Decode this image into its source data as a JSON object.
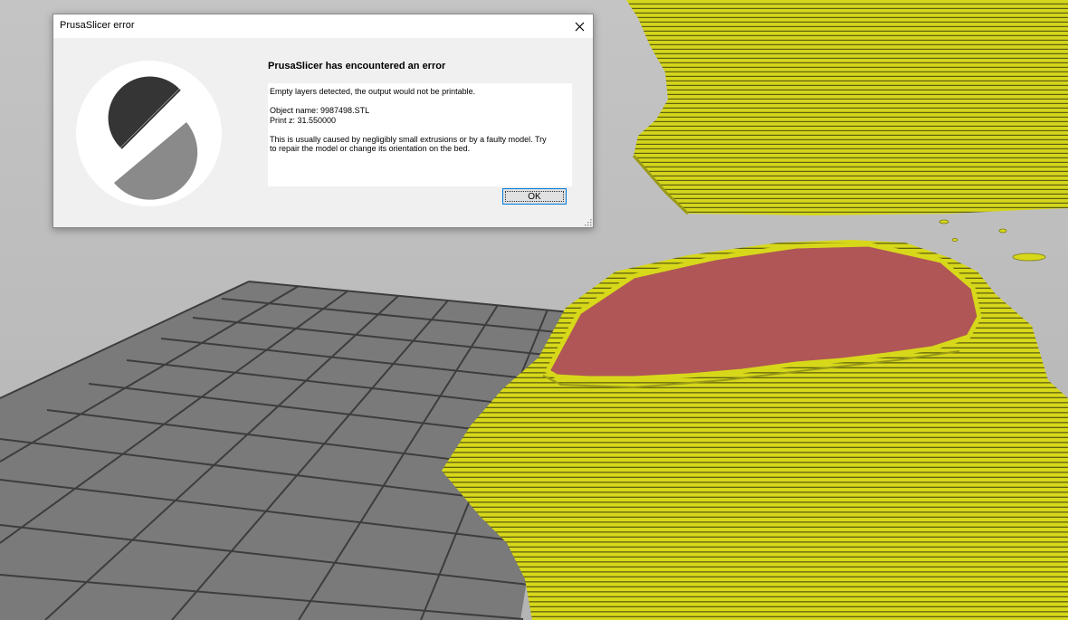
{
  "dialog": {
    "title": "PrusaSlicer error",
    "heading": "PrusaSlicer has encountered an error",
    "message": "Empty layers detected, the output would not be printable.\n\nObject name: 9987498.STL\nPrint z: 31.550000\n\nThis is usually caused by negligibly small extrusions or by a faulty model. Try\nto repair the model or change its orientation on the bed.",
    "ok_label": "OK"
  },
  "icons": {
    "close": "close-icon",
    "logo": "prusaslicer-logo-icon",
    "grip": "resize-grip-icon"
  },
  "colors": {
    "filament": "#d7d81a",
    "top_surface": "#b05656",
    "bed_grid": "#8c8c8c",
    "background": "#bcbcbc"
  }
}
